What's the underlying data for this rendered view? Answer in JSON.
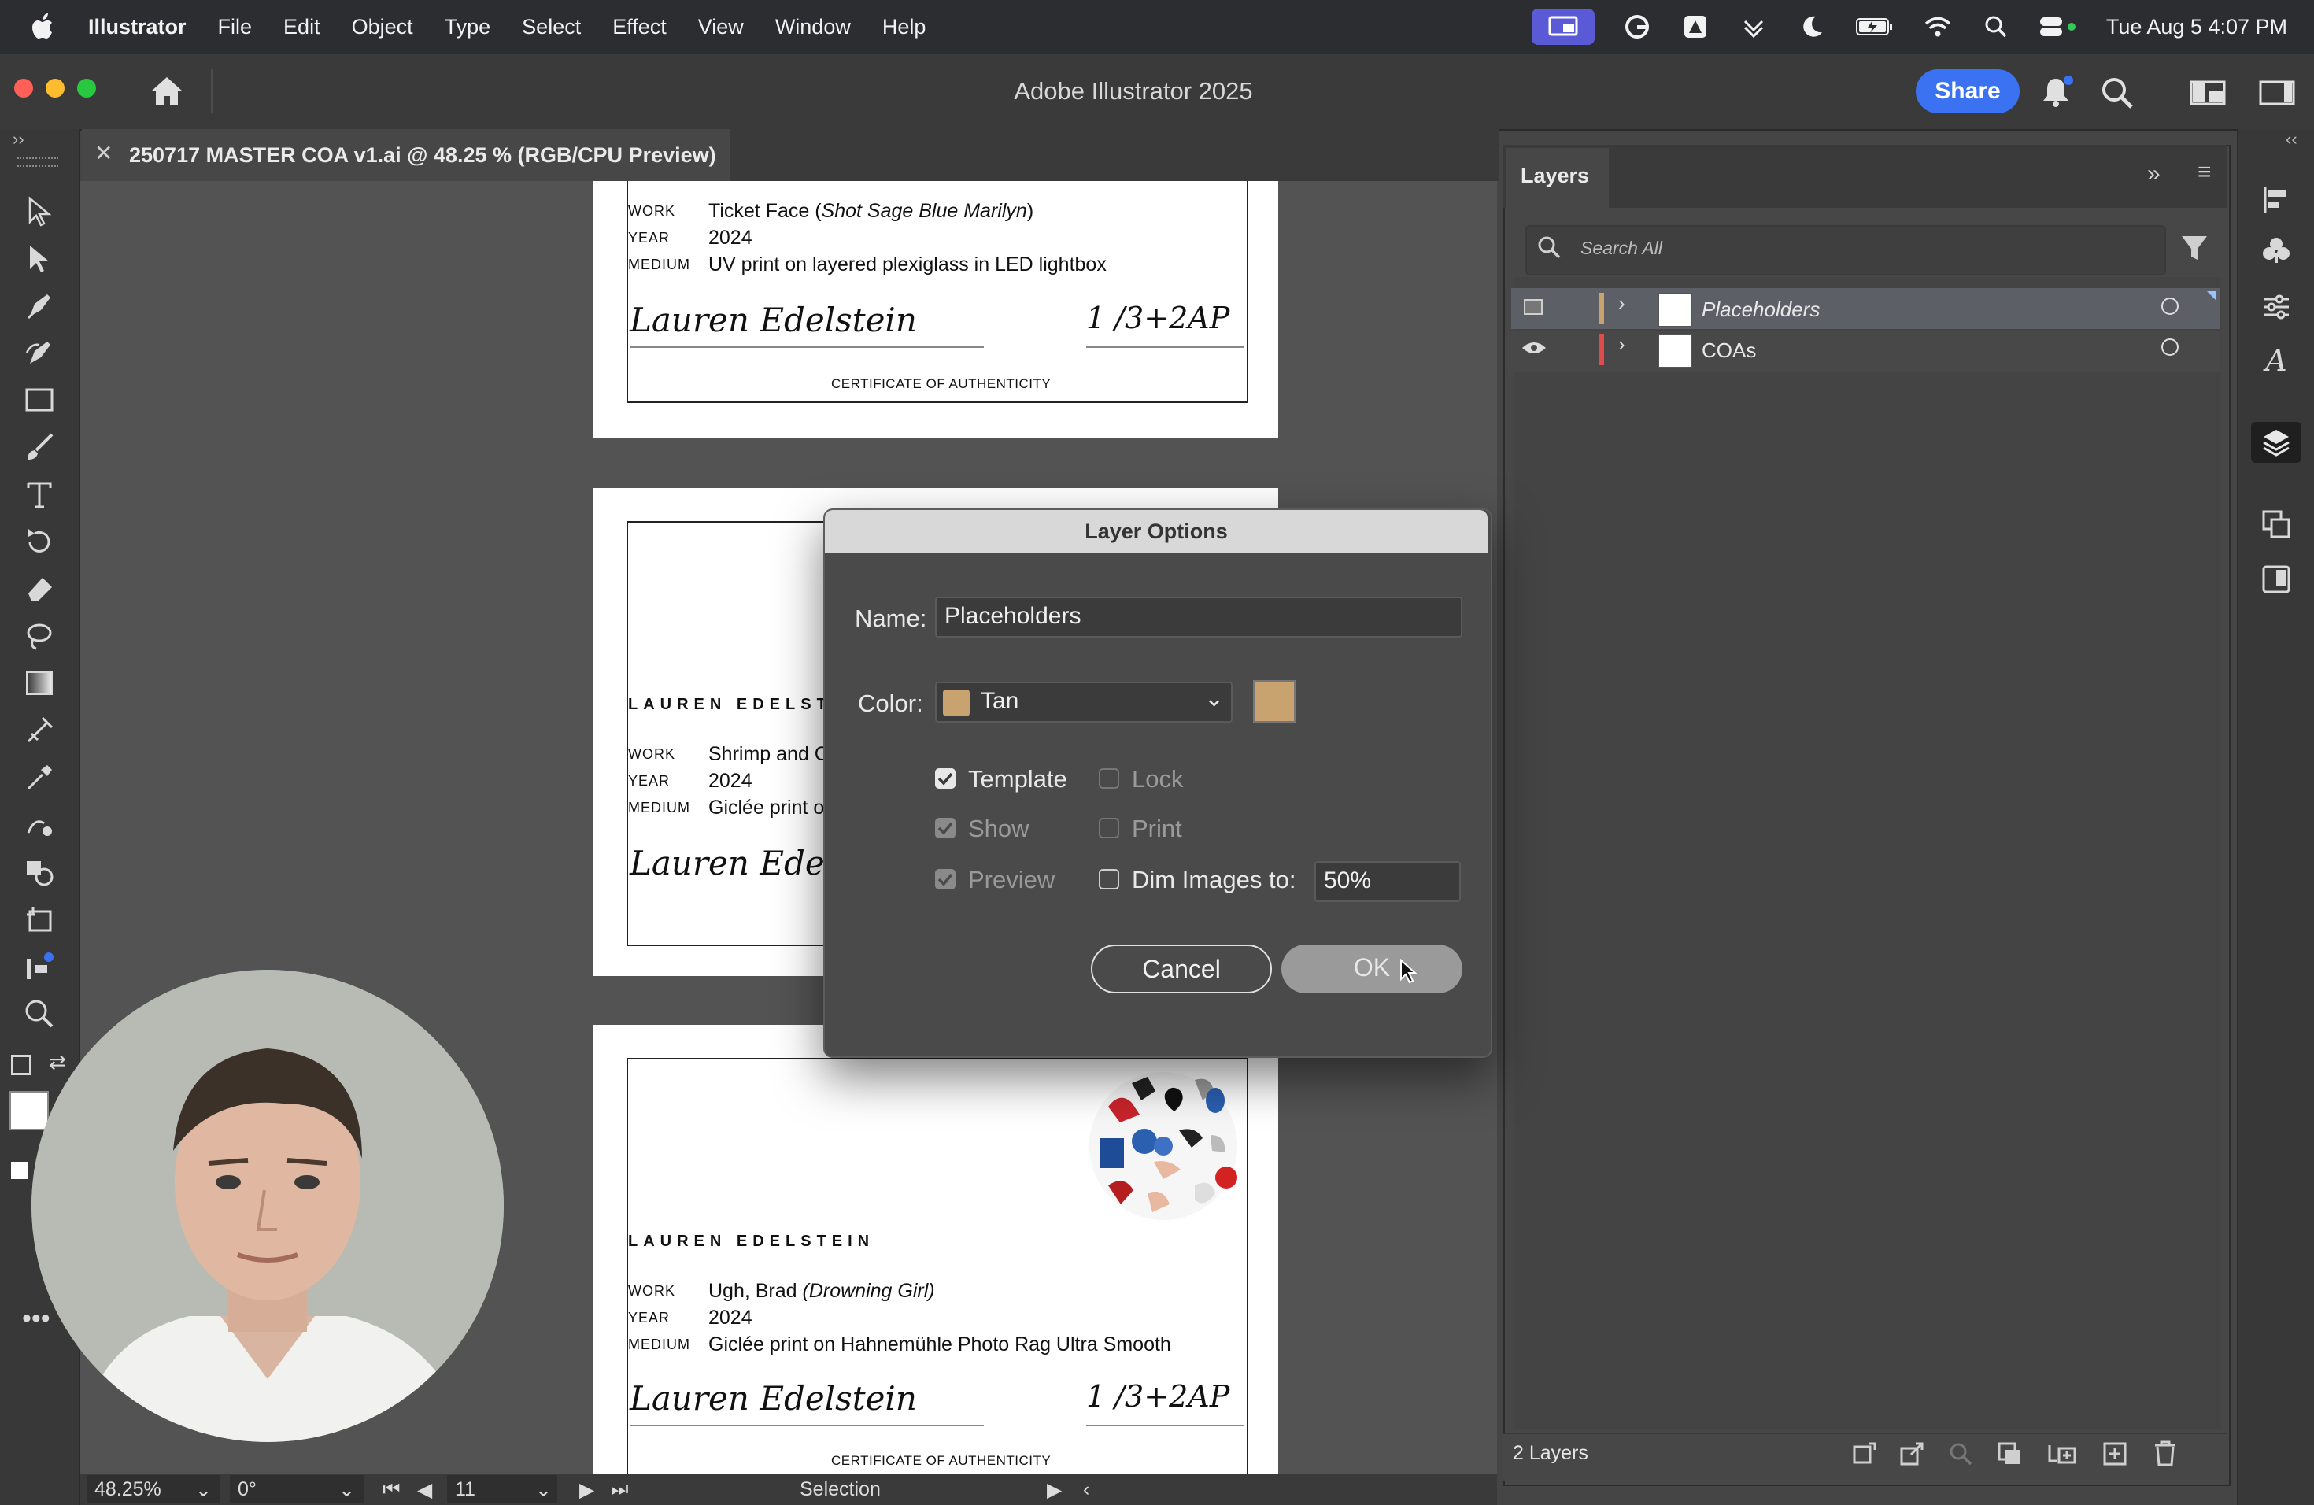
{
  "menubar": {
    "app_name": "Illustrator",
    "items": [
      "File",
      "Edit",
      "Object",
      "Type",
      "Select",
      "Effect",
      "View",
      "Window",
      "Help"
    ],
    "datetime": "Tue Aug 5  4:07 PM"
  },
  "app": {
    "title": "Adobe Illustrator 2025",
    "share_label": "Share"
  },
  "document_tab": {
    "title": "250717 MASTER COA v1.ai @ 48.25 % (RGB/CPU Preview)",
    "close_glyph": "✕"
  },
  "canvas": {
    "cert1": {
      "work_label": "WORK",
      "work_value": "Ticket Face (",
      "work_title": "Shot Sage Blue Marilyn",
      "work_close": ")",
      "year_label": "YEAR",
      "year_value": "2024",
      "medium_label": "MEDIUM",
      "medium_value": "UV print on layered plexiglass in LED lightbox",
      "signature": "Lauren Edelstein",
      "edition": "1 /3+2AP",
      "coa_label": "CERTIFICATE OF AUTHENTICITY"
    },
    "cert2": {
      "artist": "LAUREN EDELSTEI",
      "work_label": "WORK",
      "work_value": "Shrimp and C",
      "year_label": "YEAR",
      "year_value": "2024",
      "medium_label": "MEDIUM",
      "medium_value": "Giclée print o",
      "signature": "Lauren Edelstei"
    },
    "cert3": {
      "artist": "LAUREN EDELSTEIN",
      "work_label": "WORK",
      "work_value": "Ugh, Brad ",
      "work_title": "(Drowning Girl)",
      "year_label": "YEAR",
      "year_value": "2024",
      "medium_label": "MEDIUM",
      "medium_value": "Giclée print on Hahnemühle Photo Rag Ultra Smooth",
      "signature": "Lauren Edelstein",
      "edition": "1 /3+2AP",
      "coa_label": "CERTIFICATE OF AUTHENTICITY"
    }
  },
  "statusbar": {
    "zoom": "48.25%",
    "rotation": "0°",
    "artboard_number": "11",
    "tool": "Selection"
  },
  "layers_panel": {
    "tab_label": "Layers",
    "search_placeholder": "Search All",
    "layers": [
      {
        "name": "Placeholders",
        "color": "#c9a36f",
        "selected": true,
        "template": true
      },
      {
        "name": "COAs",
        "color": "#e04a4a",
        "selected": false,
        "template": false
      }
    ],
    "count_label": "2 Layers"
  },
  "dialog": {
    "title": "Layer Options",
    "name_label": "Name:",
    "name_value": "Placeholders",
    "color_label": "Color:",
    "color_value": "Tan",
    "color_hex": "#c9a36f",
    "template_label": "Template",
    "template_checked": true,
    "lock_label": "Lock",
    "lock_checked": false,
    "show_label": "Show",
    "show_checked": true,
    "print_label": "Print",
    "print_checked": false,
    "preview_label": "Preview",
    "preview_checked": true,
    "dim_label": "Dim Images to:",
    "dim_checked": false,
    "dim_value": "50%",
    "cancel_label": "Cancel",
    "ok_label": "OK"
  },
  "colors": {
    "accent_blue": "#3b72f2",
    "tan": "#c9a36f",
    "red_layer": "#e04a4a"
  }
}
